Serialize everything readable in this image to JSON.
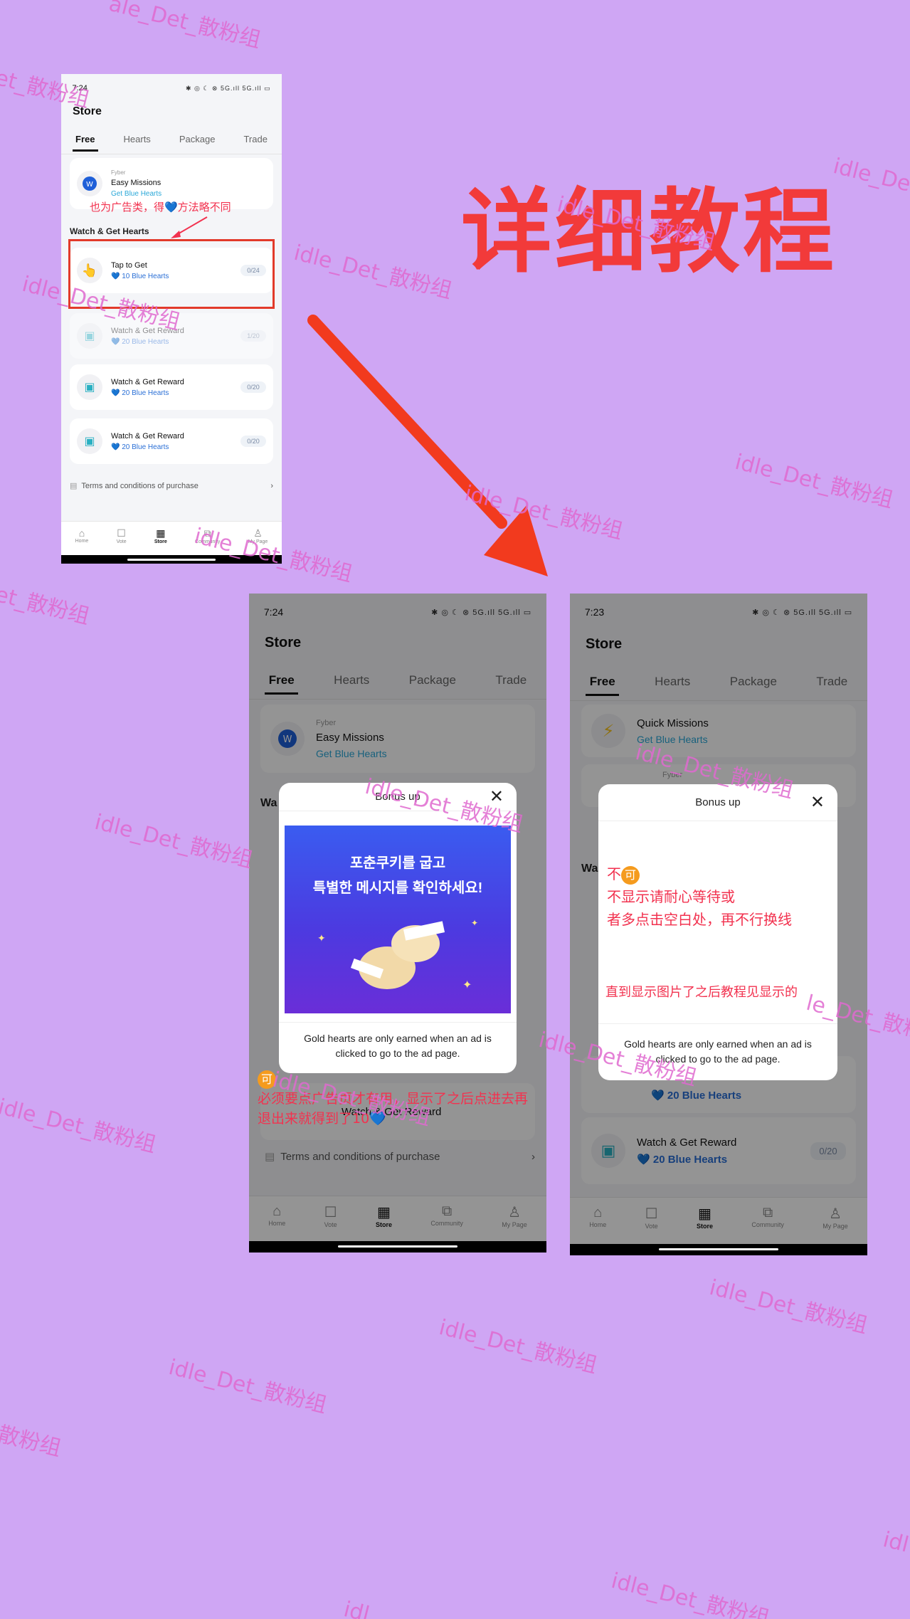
{
  "headline": "详细教程",
  "watermark": "idle_Det_散粉组",
  "watermark_partials": [
    "散粉组",
    "et_散粉组",
    "idl",
    "le_Det_散粉组",
    "ale_Det_散粉组",
    "idle_De",
    "idle_Det_散粉组"
  ],
  "colors": {
    "background": "#cfa6f4",
    "accent_red": "#f23a3a",
    "brand_blue": "#2a6fd6"
  },
  "phone1": {
    "time": "7:24",
    "status_icons": "✱ ◎ ☾ ⊗ 5G.ıll 5G.ıll ▭",
    "page_title": "Store",
    "tabs": [
      "Free",
      "Hearts",
      "Package",
      "Trade"
    ],
    "missions": {
      "provider": "Fyber",
      "title": "Easy Missions",
      "action": "Get Blue Hearts"
    },
    "annotation": "也为广告类，得💙方法略不同",
    "section_title": "Watch & Get Hearts",
    "items": [
      {
        "title": "Tap to Get",
        "reward": "10 Blue Hearts",
        "count": "0/24"
      },
      {
        "title": "Watch & Get Reward",
        "reward": "20 Blue Hearts",
        "count": "1/20"
      },
      {
        "title": "Watch & Get Reward",
        "reward": "20 Blue Hearts",
        "count": "0/20"
      },
      {
        "title": "Watch & Get Reward",
        "reward": "20 Blue Hearts",
        "count": "0/20"
      }
    ],
    "terms": "Terms and conditions of purchase",
    "nav": [
      "Home",
      "Vote",
      "Store",
      "Community",
      "My Page"
    ]
  },
  "phone2": {
    "time": "7:24",
    "status_icons": "✱ ◎ ☾ ⊗ 5G.ıll 5G.ıll ▭",
    "page_title": "Store",
    "tabs": [
      "Free",
      "Hearts",
      "Package",
      "Trade"
    ],
    "missions": {
      "provider": "Fyber",
      "title": "Easy Missions",
      "action": "Get Blue Hearts"
    },
    "section_partial": "Wa",
    "modal_title": "Bonus up",
    "ad_text_line1": "포춘쿠키를 굽고",
    "ad_text_line2": "특별한 메시지를 확인하세요!",
    "modal_footer": "Gold hearts are only earned when an ad is clicked to go to the ad page.",
    "behind_item": "Watch & Get Reward",
    "annotation_mark": "可",
    "annotation": "必须要点广告页才有用，显示了之后点进去再退出来就得到了10💙",
    "terms": "Terms and conditions of purchase",
    "nav": [
      "Home",
      "Vote",
      "Store",
      "Community",
      "My Page"
    ]
  },
  "phone3": {
    "time": "7:23",
    "status_icons": "✱ ◎ ☾ ⊗ 5G.ıll 5G.ıll ▭",
    "page_title": "Store",
    "tabs": [
      "Free",
      "Hearts",
      "Package",
      "Trade"
    ],
    "quick": {
      "title": "Quick Missions",
      "action": "Get Blue Hearts"
    },
    "provider": "Fyber",
    "section_partial": "Wa",
    "modal_title": "Bonus up",
    "annotation_mark_prefix": "不",
    "annotation_mark": "可",
    "annotation_line1": "不显示请耐心等待或",
    "annotation_line2": "者多点击空白处，再不行换线",
    "annotation_line3": "直到显示图片了之后教程见显示的",
    "modal_footer": "Gold hearts are only earned when an ad is clicked to go to the ad page.",
    "behind_reward": "20 Blue Hearts",
    "last_item": {
      "title": "Watch & Get Reward",
      "reward": "20 Blue Hearts",
      "count": "0/20"
    },
    "nav": [
      "Home",
      "Vote",
      "Store",
      "Community",
      "My Page"
    ]
  }
}
